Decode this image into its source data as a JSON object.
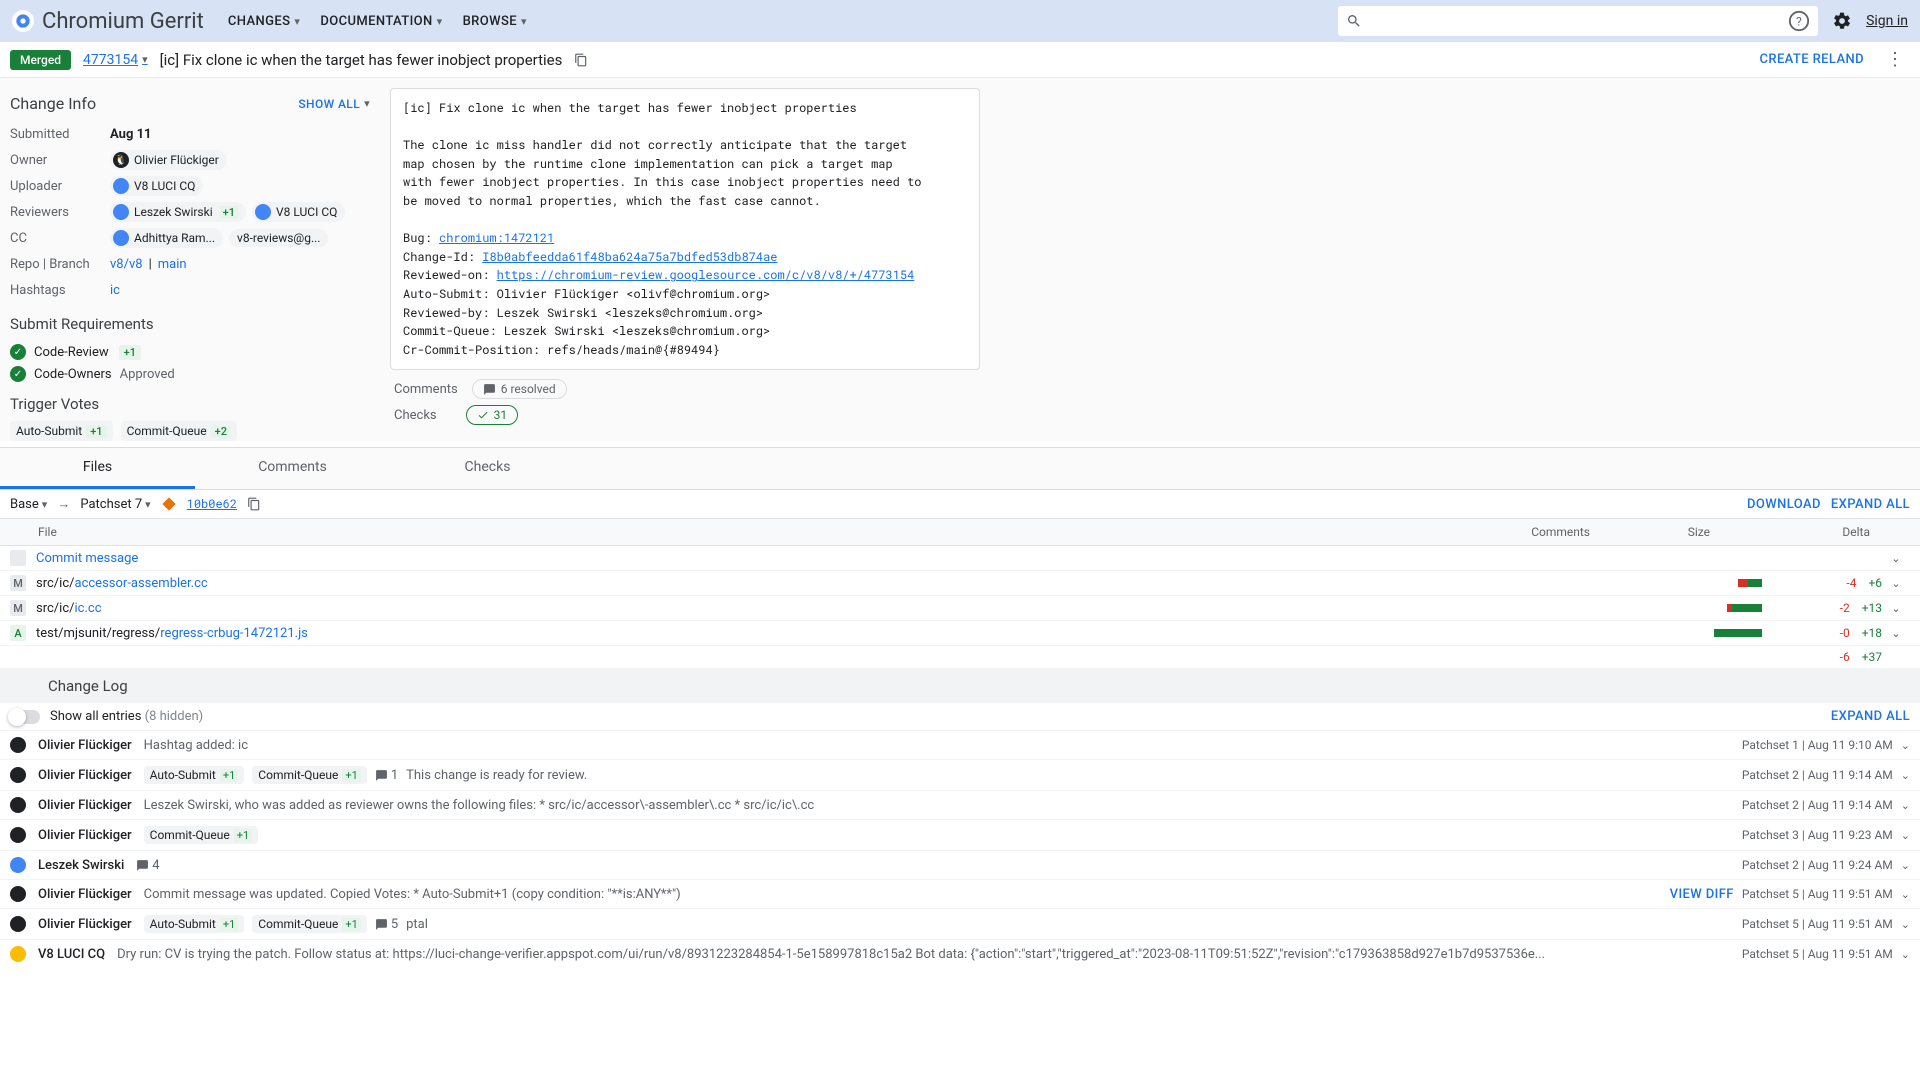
{
  "brand": "Chromium Gerrit",
  "nav": {
    "changes": "CHANGES",
    "documentation": "DOCUMENTATION",
    "browse": "BROWSE"
  },
  "signin": "Sign in",
  "changebar": {
    "status": "Merged",
    "number": "4773154",
    "title": "[ic] Fix clone ic when the target has fewer inobject properties",
    "create_reland": "CREATE RELAND"
  },
  "left": {
    "change_info": "Change Info",
    "show_all": "SHOW ALL",
    "submitted_label": "Submitted",
    "submitted_val": "Aug 11",
    "owner_label": "Owner",
    "owner": "Olivier Flückiger",
    "uploader_label": "Uploader",
    "uploader": "V8 LUCI CQ",
    "reviewers_label": "Reviewers",
    "reviewer1": "Leszek Swirski",
    "reviewer1_vote": "+1",
    "reviewer2": "V8 LUCI CQ",
    "cc_label": "CC",
    "cc1": "Adhittya Ram...",
    "cc2": "v8-reviews@g...",
    "repo_label": "Repo | Branch",
    "repo_link": "v8/v8",
    "repo_sep": " | ",
    "branch_link": "main",
    "hashtags_label": "Hashtags",
    "hashtag": "ic",
    "submit_req": "Submit Requirements",
    "req1": "Code-Review",
    "req1_vote": "+1",
    "req2": "Code-Owners",
    "req2_status": "Approved",
    "trigger": "Trigger Votes",
    "tv1_label": "Auto-Submit",
    "tv1_vote": "+1",
    "tv2_label": "Commit-Queue",
    "tv2_vote": "+2"
  },
  "commit": {
    "title": "[ic] Fix clone ic when the target has fewer inobject properties",
    "body1": "The clone ic miss handler did not correctly anticipate that the target\nmap chosen by the runtime clone implementation can pick a target map\nwith fewer inobject properties. In this case inobject properties need to\nbe moved to normal properties, which the fast case cannot.",
    "bug_label": "Bug: ",
    "bug_link": "chromium:1472121",
    "changeid_label": "Change-Id: ",
    "changeid_link": "I8b0abfeedda61f48ba624a75a7bdfed53db874ae",
    "reviewed_label": "Reviewed-on: ",
    "reviewed_link": "https://chromium-review.googlesource.com/c/v8/v8/+/4773154",
    "trailer": "Auto-Submit: Olivier Flückiger <olivf@chromium.org>\nReviewed-by: Leszek Swirski <leszeks@chromium.org>\nCommit-Queue: Leszek Swirski <leszeks@chromium.org>\nCr-Commit-Position: refs/heads/main@{#89494}"
  },
  "summary": {
    "comments_label": "Comments",
    "comments_count": "6 resolved",
    "checks_label": "Checks",
    "checks_count": "31"
  },
  "tabs": {
    "files": "Files",
    "comments": "Comments",
    "checks": "Checks"
  },
  "files_toolbar": {
    "base": "Base",
    "arrow": "→",
    "patchset": "Patchset 7",
    "sha": "10b0e62",
    "download": "DOWNLOAD",
    "expand_all": "EXPAND ALL"
  },
  "file_headers": {
    "file": "File",
    "comments": "Comments",
    "size": "Size",
    "delta": "Delta"
  },
  "files": [
    {
      "status": "",
      "dir": "",
      "name": "Commit message",
      "link": true,
      "del": "",
      "add": "",
      "bar_del": 0,
      "bar_add": 0,
      "expand": true
    },
    {
      "status": "M",
      "dir": "src/ic/",
      "name": "accessor-assembler.cc",
      "link": true,
      "del": "-4",
      "add": "+6",
      "bar_del": 10,
      "bar_add": 14,
      "expand": true
    },
    {
      "status": "M",
      "dir": "src/ic/",
      "name": "ic.cc",
      "link": true,
      "del": "-2",
      "add": "+13",
      "bar_del": 5,
      "bar_add": 30,
      "expand": true
    },
    {
      "status": "A",
      "dir": "test/mjsunit/regress/",
      "name": "regress-crbug-1472121.js",
      "link": true,
      "del": "-0",
      "add": "+18",
      "bar_del": 0,
      "bar_add": 48,
      "expand": true
    }
  ],
  "totals": {
    "del": "-6",
    "add": "+37"
  },
  "changelog": {
    "title": "Change Log",
    "show_all_label": "Show all entries ",
    "hidden": "(8 hidden)",
    "expand_all": "EXPAND ALL"
  },
  "log": [
    {
      "avatar": "dark",
      "author": "Olivier Flückiger",
      "chips": [],
      "comments": "",
      "text": "Hashtag added: ic",
      "view_diff": false,
      "meta": "Patchset 1 | Aug 11 9:10 AM"
    },
    {
      "avatar": "dark",
      "author": "Olivier Flückiger",
      "chips": [
        [
          "Auto-Submit",
          "+1"
        ],
        [
          "Commit-Queue",
          "+1"
        ]
      ],
      "comments": "1",
      "text": "This change is ready for review.",
      "view_diff": false,
      "meta": "Patchset 2 | Aug 11 9:14 AM"
    },
    {
      "avatar": "dark",
      "author": "Olivier Flückiger",
      "chips": [],
      "comments": "",
      "text": "Leszek Swirski, who was added as reviewer owns the following files: * src/ic/accessor\\-assembler\\.cc * src/ic/ic\\.cc",
      "view_diff": false,
      "meta": "Patchset 2 | Aug 11 9:14 AM"
    },
    {
      "avatar": "dark",
      "author": "Olivier Flückiger",
      "chips": [
        [
          "Commit-Queue",
          "+1"
        ]
      ],
      "comments": "",
      "text": "",
      "view_diff": false,
      "meta": "Patchset 3 | Aug 11 9:23 AM"
    },
    {
      "avatar": "blue",
      "author": "Leszek Swirski",
      "chips": [],
      "comments": "4",
      "text": "",
      "view_diff": false,
      "meta": "Patchset 2 | Aug 11 9:24 AM"
    },
    {
      "avatar": "dark",
      "author": "Olivier Flückiger",
      "chips": [],
      "comments": "",
      "text": "Commit message was updated. Copied Votes: * Auto-Submit+1 (copy condition: \"**is:ANY**\")",
      "view_diff": true,
      "meta": "Patchset 5 | Aug 11 9:51 AM"
    },
    {
      "avatar": "dark",
      "author": "Olivier Flückiger",
      "chips": [
        [
          "Auto-Submit",
          "+1"
        ],
        [
          "Commit-Queue",
          "+1"
        ]
      ],
      "comments": "5",
      "text": "ptal",
      "view_diff": false,
      "meta": "Patchset 5 | Aug 11 9:51 AM"
    },
    {
      "avatar": "bot",
      "author": "V8 LUCI CQ",
      "chips": [],
      "comments": "",
      "text": "Dry run: CV is trying the patch. Follow status at: https://luci-change-verifier.appspot.com/ui/run/v8/8931223284854-1-5e158997818c15a2 Bot data: {\"action\":\"start\",\"triggered_at\":\"2023-08-11T09:51:52Z\",\"revision\":\"c179363858d927e1b7d9537536e...",
      "view_diff": false,
      "meta": "Patchset 5 | Aug 11 9:51 AM",
      "truncate": true
    }
  ],
  "view_diff_label": "VIEW DIFF"
}
